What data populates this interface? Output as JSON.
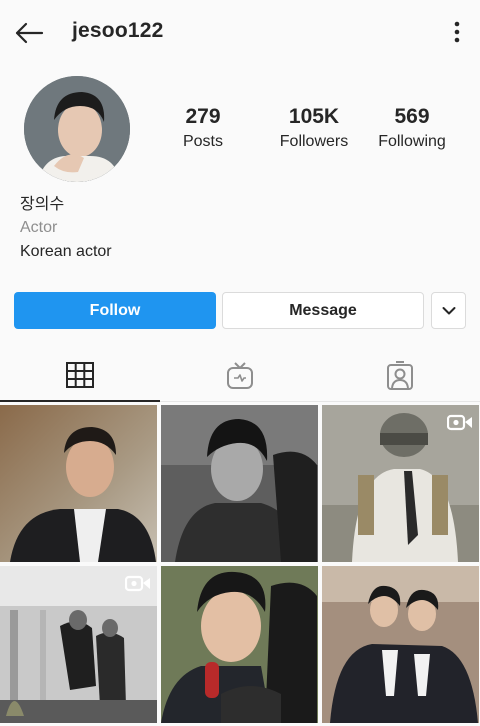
{
  "header": {
    "username": "jesoo122",
    "back_icon": "arrow-left-icon",
    "more_icon": "vertical-ellipsis-icon"
  },
  "profile": {
    "stats": [
      {
        "value": "279",
        "label": "Posts"
      },
      {
        "value": "105K",
        "label": "Followers"
      },
      {
        "value": "569",
        "label": "Following"
      }
    ],
    "name": "장의수",
    "category": "Actor",
    "bio": "Korean actor"
  },
  "actions": {
    "follow_label": "Follow",
    "message_label": "Message",
    "suggest_icon": "chevron-down-icon"
  },
  "tabs": [
    {
      "name": "grid",
      "icon": "grid-icon",
      "active": true
    },
    {
      "name": "igtv",
      "icon": "igtv-icon",
      "active": false
    },
    {
      "name": "tagged",
      "icon": "tagged-user-icon",
      "active": false
    }
  ],
  "posts": [
    {
      "badge": null,
      "tone": "color"
    },
    {
      "badge": null,
      "tone": "grayscale"
    },
    {
      "badge": "video-icon",
      "tone": "muted"
    },
    {
      "badge": "video-icon",
      "tone": "grayscale"
    },
    {
      "badge": null,
      "tone": "color"
    },
    {
      "badge": null,
      "tone": "color"
    }
  ],
  "colors": {
    "accent": "#1f95f0",
    "background": "#fafafa",
    "text": "#262626",
    "secondary_text": "#8e8e8e",
    "border": "#dbdbdb"
  }
}
